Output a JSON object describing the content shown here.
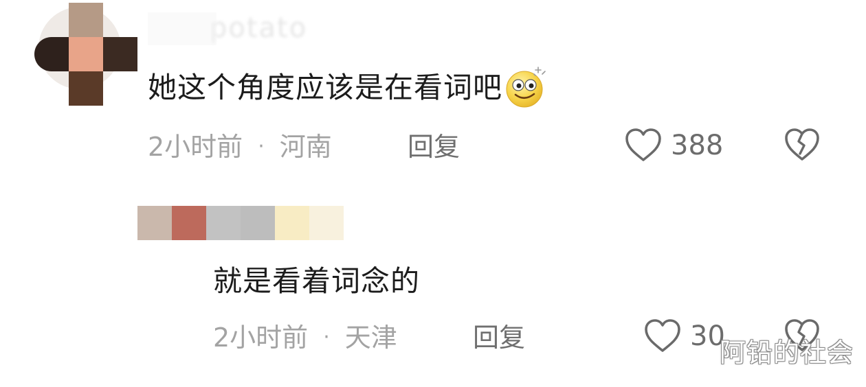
{
  "comments": [
    {
      "username_visible_fragment": "potato",
      "text": "她这个角度应该是在看词吧",
      "emoji": "sparkle-eyes-smile-emoji",
      "time": "2小时前",
      "location": "河南",
      "reply_label": "回复",
      "likes": "388"
    },
    {
      "text": "就是看着词念的",
      "time": "2小时前",
      "location": "天津",
      "reply_label": "回复",
      "likes": "30"
    }
  ],
  "separator": "·",
  "watermark": "阿铅的社会",
  "icons": {
    "like": "heart-outline-icon",
    "dislike": "broken-heart-outline-icon"
  },
  "colors": {
    "text": "#1c1c1c",
    "meta": "#a3a3a3",
    "reply": "#6f6f6f",
    "count": "#6c6c6c"
  }
}
